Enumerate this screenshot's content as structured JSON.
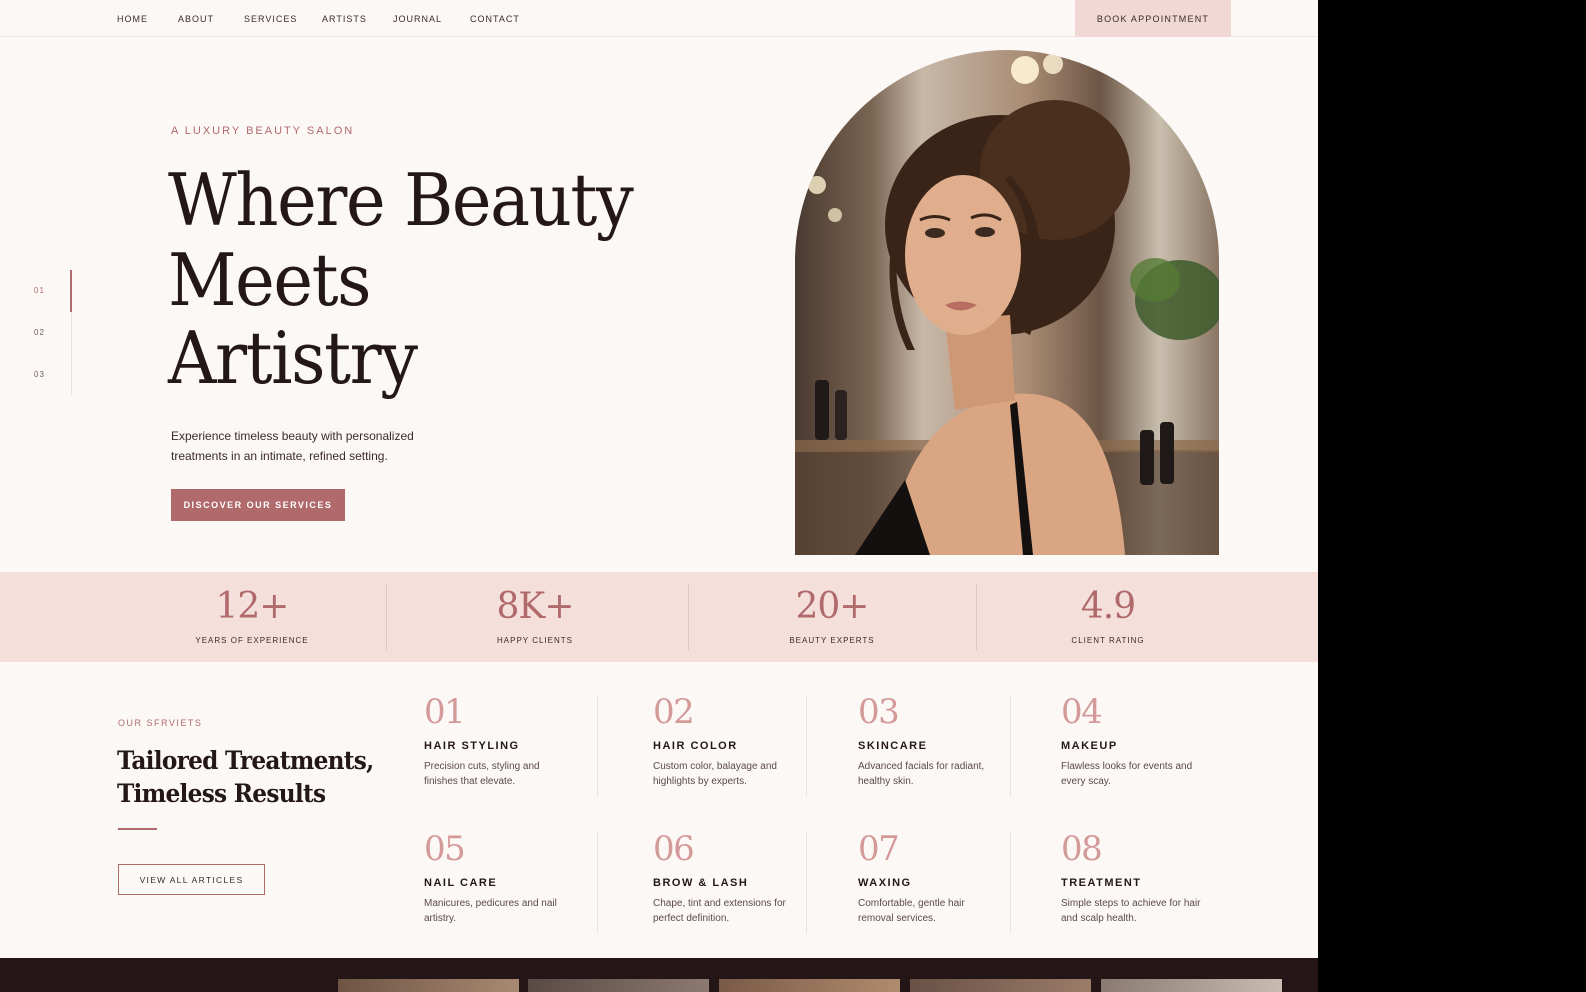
{
  "nav": {
    "links": [
      "HOME",
      "ABOUT",
      "SERVICES",
      "ARTISTS",
      "JOURNAL",
      "CONTACT"
    ],
    "book_label": "BOOK APPOINTMENT"
  },
  "slides": [
    "01",
    "02",
    "03"
  ],
  "hero": {
    "eyebrow": "A LUXURY BEAUTY SALON",
    "title_lines": [
      "Where Beauty",
      "Meets",
      "Artistry"
    ],
    "subtitle_lines": [
      "Experience timeless beauty with personalized",
      "treatments in an intimate, refined setting."
    ],
    "cta_label": "DISCOVER OUR SERVICES"
  },
  "stats": [
    {
      "value": "12+",
      "label": "YEARS OF EXPERIENCE"
    },
    {
      "value": "8K+",
      "label": "HAPPY CLIENTS"
    },
    {
      "value": "20+",
      "label": "BEAUTY EXPERTS"
    },
    {
      "value": "4.9",
      "label": "CLIENT RATING"
    }
  ],
  "services": {
    "eyebrow": "OUR SFRVIETS",
    "title_lines": [
      "Tailored Treatments,",
      "Timeless Results"
    ],
    "view_all_label": "VIEW ALL ARTICLES",
    "items": [
      {
        "num": "01",
        "name": "HAIR STYLING",
        "desc": "Precision cuts, styling and finishes that elevate."
      },
      {
        "num": "02",
        "name": "HAIR COLOR",
        "desc": "Custom color, balayage and highlights by experts."
      },
      {
        "num": "03",
        "name": "SKINCARE",
        "desc": "Advanced facials for radiant, healthy skin."
      },
      {
        "num": "04",
        "name": "MAKEUP",
        "desc": "Flawless looks for events and every scay."
      },
      {
        "num": "05",
        "name": "NAIL CARE",
        "desc": "Manicures, pedicures and nail artistry."
      },
      {
        "num": "06",
        "name": "BROW & LASH",
        "desc": "Chape, tint and extensions for perfect definition."
      },
      {
        "num": "07",
        "name": "WAXING",
        "desc": "Comfortable, gentle hair removal services."
      },
      {
        "num": "08",
        "name": "TREATMENT",
        "desc": "Simple steps to achieve for hair and scalp health."
      }
    ]
  },
  "colors": {
    "accent": "#b06a6c",
    "stats_band": "#f5dfdb",
    "page_bg": "#fcf8f6",
    "text_dark": "#241717"
  }
}
